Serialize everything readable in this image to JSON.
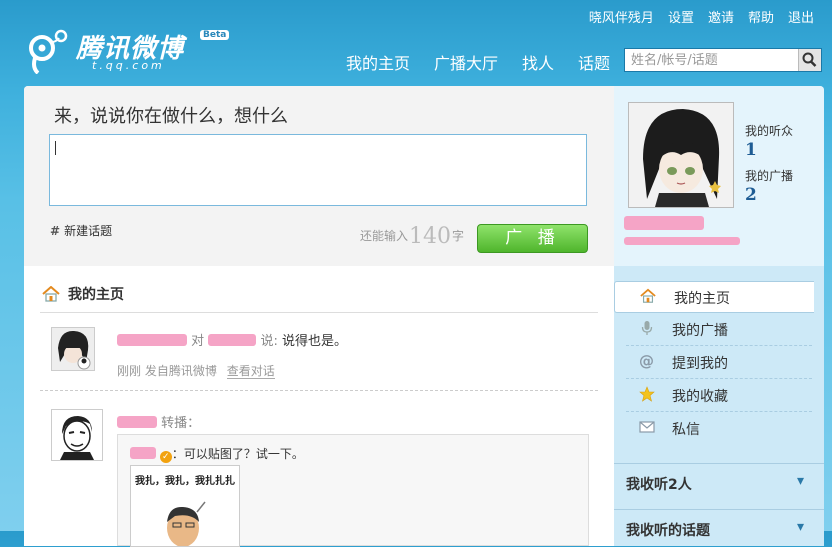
{
  "topbar": {
    "links": [
      "晓风伴残月",
      "设置",
      "邀请",
      "帮助",
      "退出"
    ]
  },
  "logo": {
    "title": "腾讯微博",
    "sub": "t.qq.com",
    "badge": "Beta"
  },
  "nav": {
    "items": [
      "我的主页",
      "广播大厅",
      "找人",
      "话题"
    ]
  },
  "search": {
    "placeholder": "姓名/帐号/话题"
  },
  "composer": {
    "prompt": "来，说说你在做什么，想什么",
    "new_topic": "新建话题",
    "counter_prefix": "还能输入",
    "counter_value": "140",
    "counter_suffix": "字",
    "submit": "广 播"
  },
  "feed": {
    "title": "我的主页",
    "posts": [
      {
        "connector": "对",
        "said": "说:",
        "text": "说得也是。",
        "time": "刚刚",
        "source": "发自腾讯微博",
        "link": "查看对话"
      },
      {
        "action": "转播：",
        "repost_text": "：可以贴图了？试一下。",
        "image_caption": "我扎，我扎，我扎扎扎"
      }
    ]
  },
  "profile": {
    "followers_label": "我的听众",
    "followers": "1",
    "posts_label": "我的广播",
    "posts": "2"
  },
  "menu": {
    "items": [
      {
        "label": "我的主页",
        "icon": "house-icon"
      },
      {
        "label": "我的广播",
        "icon": "microphone-icon"
      },
      {
        "label": "提到我的",
        "icon": "at-icon"
      },
      {
        "label": "我的收藏",
        "icon": "star-icon"
      },
      {
        "label": "私信",
        "icon": "envelope-icon"
      }
    ]
  },
  "sidebar_blocks": {
    "following": "我收听2人",
    "topics": "我收听的话题"
  },
  "colors": {
    "accent": "#3eb0dd",
    "button_green": "#4fb52c",
    "link_blue": "#1e5c94"
  }
}
